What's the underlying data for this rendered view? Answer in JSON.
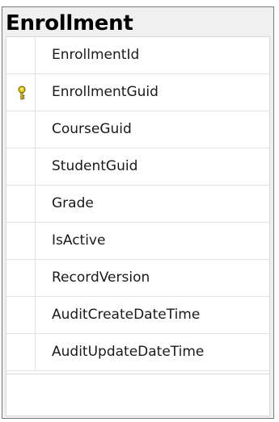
{
  "table": {
    "title": "Enrollment",
    "columns": [
      {
        "name": "EnrollmentId",
        "primary_key": false
      },
      {
        "name": "EnrollmentGuid",
        "primary_key": true
      },
      {
        "name": "CourseGuid",
        "primary_key": false
      },
      {
        "name": "StudentGuid",
        "primary_key": false
      },
      {
        "name": "Grade",
        "primary_key": false
      },
      {
        "name": "IsActive",
        "primary_key": false
      },
      {
        "name": "RecordVersion",
        "primary_key": false
      },
      {
        "name": "AuditCreateDateTime",
        "primary_key": false
      },
      {
        "name": "AuditUpdateDateTime",
        "primary_key": false
      }
    ]
  },
  "icons": {
    "primary_key": "key-icon"
  },
  "colors": {
    "key_fill": "#e8c800",
    "key_stroke": "#6b5a00",
    "header_background": "#f0f0f0"
  }
}
